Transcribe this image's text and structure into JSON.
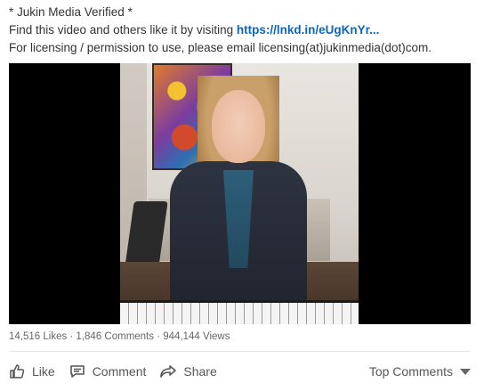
{
  "post": {
    "caption_line1": "* Jukin Media Verified *",
    "caption_line2_prefix": "Find this video and others like it by visiting ",
    "caption_link": "https://lnkd.in/eUgKnYr...",
    "caption_line3": "For licensing / permission to use, please email licensing(at)jukinmedia(dot)com."
  },
  "stats": {
    "text": "14,516 Likes · 1,846 Comments · 944,144 Views"
  },
  "actions": {
    "like": "Like",
    "comment": "Comment",
    "share": "Share",
    "sort_label": "Top Comments"
  },
  "icons": {
    "like": "thumbs-up-icon",
    "comment": "comment-icon",
    "share": "share-arrow-icon",
    "sort": "caret-down-icon"
  },
  "colors": {
    "link": "#0a66c2",
    "text": "#333333",
    "muted": "#666666"
  }
}
